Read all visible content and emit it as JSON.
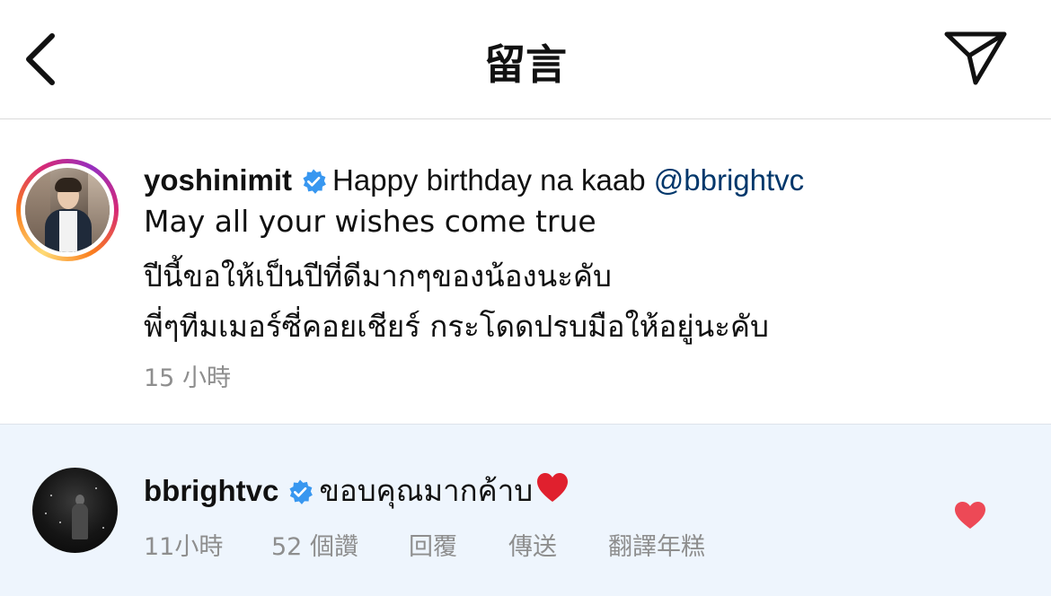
{
  "header": {
    "title": "留言",
    "back_icon": "chevron-left-icon",
    "send_icon": "paper-plane-icon"
  },
  "comment": {
    "username": "yoshinimit",
    "verified": true,
    "text_first": "Happy birthday na kaab",
    "mention": "@bbrightvc",
    "line2": "May all your wishes come true",
    "line3": "ปีนี้ขอให้เป็นปีที่ดีมากๆของน้องนะคับ",
    "line4": "พี่ๆทีมเมอร์ซี่คอยเชียร์ กระโดดปรบมือให้อยู่นะคับ",
    "time": "15 小時",
    "story_ring_colors": [
      "#feda75",
      "#fa7e1e",
      "#d62976",
      "#962fbf"
    ]
  },
  "reply": {
    "username": "bbrightvc",
    "verified": true,
    "text": "ขอบคุณมากค้าบ",
    "emoji": "red-heart-emoji",
    "time": "11小時",
    "likes": "52 個讚",
    "reply_label": "回覆",
    "send_label": "傳送",
    "translate_label": "翻譯年糕",
    "liked": true,
    "like_color": "#ed4956",
    "background_color": "#eef5fd"
  },
  "colors": {
    "verified_badge": "#3897f0",
    "mention": "#00376b",
    "meta_text": "#8e8e8e"
  }
}
